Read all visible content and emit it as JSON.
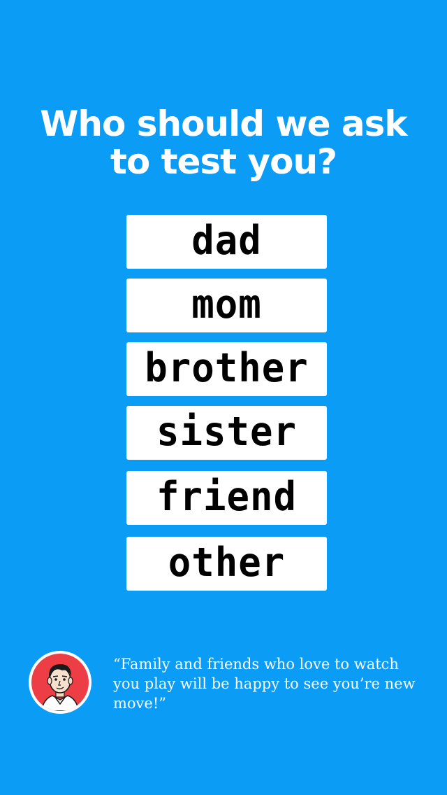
{
  "screen": {
    "title_line1": "Who should we ask",
    "title_line2": "to test you?",
    "options": [
      {
        "label": "dad"
      },
      {
        "label": "mom"
      },
      {
        "label": "brother"
      },
      {
        "label": "sister"
      },
      {
        "label": "friend"
      },
      {
        "label": "other"
      }
    ],
    "quote": "“Family and friends who love to watch you play will be happy to see you’re new move!”"
  },
  "colors": {
    "background": "#0b9cf5",
    "button": "#ffffff",
    "avatar_ring": "#ee3e45"
  },
  "icons": {
    "avatar": "avatar-man-portrait"
  }
}
